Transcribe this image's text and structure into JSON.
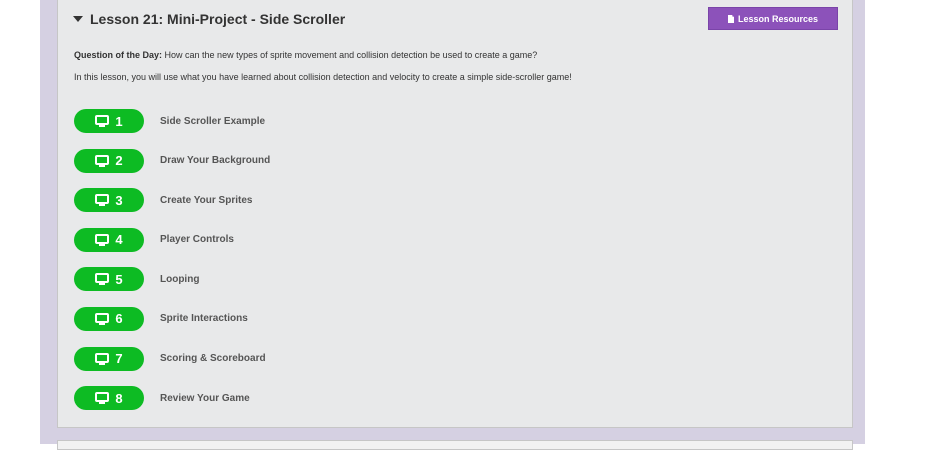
{
  "lesson": {
    "title": "Lesson 21: Mini-Project - Side Scroller",
    "resources_label": "Lesson Resources",
    "qotd_label": "Question of the Day:",
    "qotd_text": "How can the new types of sprite movement and collision detection be used to create a game?",
    "intro": "In this lesson, you will use what you have learned about collision detection and velocity to create a simple side-scroller game!"
  },
  "levels": [
    {
      "num": "1",
      "label": "Side Scroller Example"
    },
    {
      "num": "2",
      "label": "Draw Your Background"
    },
    {
      "num": "3",
      "label": "Create Your Sprites"
    },
    {
      "num": "4",
      "label": "Player Controls"
    },
    {
      "num": "5",
      "label": "Looping"
    },
    {
      "num": "6",
      "label": "Sprite Interactions"
    },
    {
      "num": "7",
      "label": "Scoring & Scoreboard"
    },
    {
      "num": "8",
      "label": "Review Your Game"
    }
  ],
  "colors": {
    "pill": "#0dbb23",
    "resources_button": "#8c52ba",
    "outer_background": "#d5d0e2"
  },
  "icons": {
    "level": "monitor-icon",
    "header": "caret-down-icon",
    "resources": "document-icon"
  }
}
